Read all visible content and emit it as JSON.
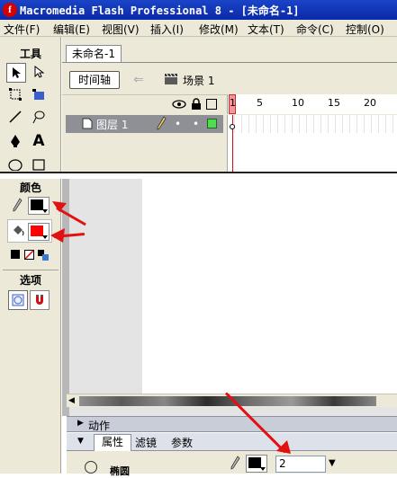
{
  "window": {
    "title": "Macromedia Flash Professional 8 - [未命名-1]",
    "logo_letter": "f"
  },
  "menu": [
    "文件(F)",
    "编辑(E)",
    "视图(V)",
    "插入(I)",
    "修改(M)",
    "文本(T)",
    "命令(C)",
    "控制(O)"
  ],
  "tools": {
    "heading": "工具"
  },
  "document": {
    "tab": "未命名-1",
    "timeline_button": "时间轴",
    "scene_label": "场景 1"
  },
  "timeline": {
    "layer_name": "图层 1",
    "ruler_ticks": [
      "1",
      "5",
      "10",
      "15",
      "20"
    ]
  },
  "colors_panel": {
    "heading": "颜色",
    "stroke_color": "#000000",
    "fill_color": "#ff0000"
  },
  "options_panel": {
    "heading": "选项"
  },
  "panels": {
    "actions_label": "动作",
    "tabs": [
      "属性",
      "滤镜",
      "参数"
    ],
    "stroke_value": "2",
    "partial_label": "椭圆"
  },
  "annotation_color": "#e31010"
}
